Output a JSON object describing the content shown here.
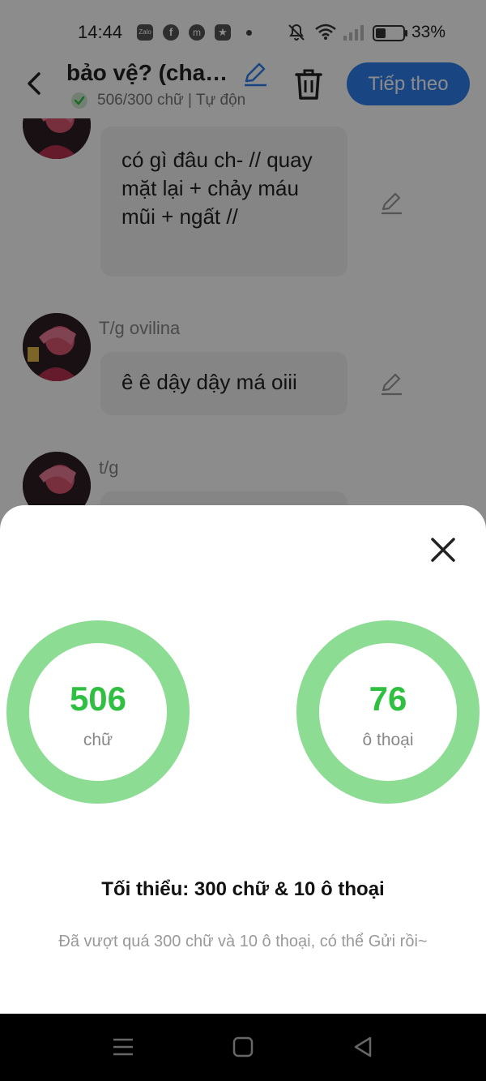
{
  "status_bar": {
    "time": "14:44",
    "apps": [
      "Zalo",
      "f",
      "m",
      "★"
    ],
    "battery": "33%",
    "icons": [
      "mute-icon",
      "wifi-icon",
      "signal-icon",
      "battery-icon"
    ]
  },
  "header": {
    "title": "bảo vệ? (chap...",
    "word_status": "506/300 chữ | Tự độn",
    "next_label": "Tiếp theo"
  },
  "chat": {
    "messages": [
      {
        "speaker": "",
        "text": "có gì đâu ch- // quay mặt lại + chảy máu mũi + ngất //"
      },
      {
        "speaker": "T/g ovilina",
        "text": "ê ê dậy dậy má oiii"
      },
      {
        "speaker": "t/g",
        "text": ""
      }
    ]
  },
  "stats": {
    "words": {
      "value": "506",
      "label": "chữ"
    },
    "dialogues": {
      "value": "76",
      "label": "ô thoại"
    }
  },
  "minimum_text": "Tối thiểu: 300 chữ & 10 ô thoại",
  "note_text": "Đã vượt quá 300 chữ và 10 ô thoại, có thể Gửi rồi~",
  "colors": {
    "accent": "#2f80ed",
    "ring": "#8ddc94",
    "stat_value": "#2fc041"
  }
}
